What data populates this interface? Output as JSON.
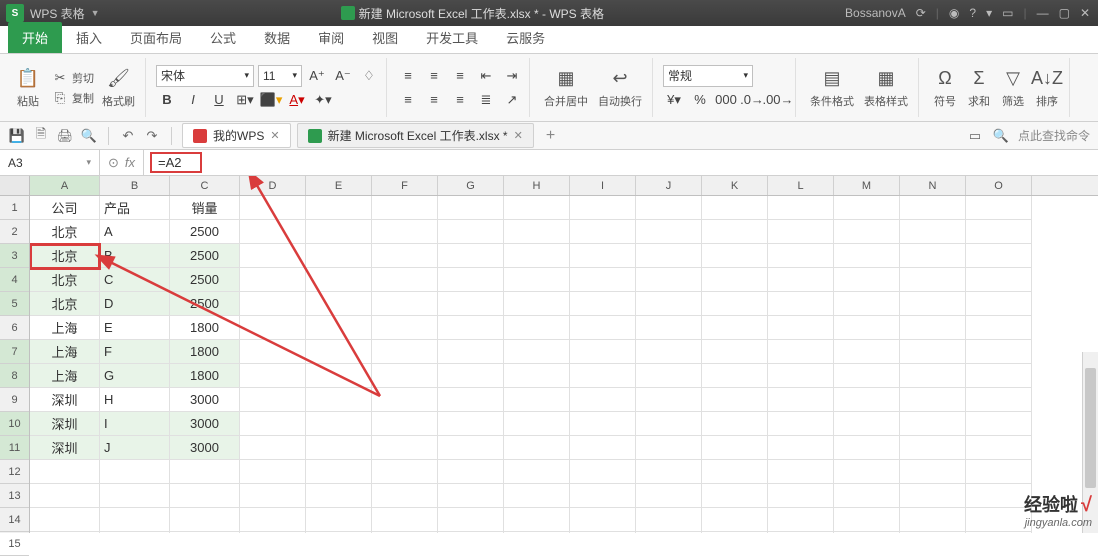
{
  "titlebar": {
    "app_name": "WPS 表格",
    "doc_title": "新建 Microsoft Excel 工作表.xlsx * - WPS 表格",
    "user": "BossanovA",
    "sync_icon": "sync-icon",
    "buttons": [
      "◎",
      "?",
      "▾",
      "▢",
      "—",
      "▢",
      "✕"
    ]
  },
  "menu": {
    "tabs": [
      "开始",
      "插入",
      "页面布局",
      "公式",
      "数据",
      "审阅",
      "视图",
      "开发工具",
      "云服务"
    ],
    "active": 0
  },
  "ribbon": {
    "paste": "粘贴",
    "cut": "剪切",
    "copy": "复制",
    "format_painter": "格式刷",
    "font_name": "宋体",
    "font_size": "11",
    "merge_center": "合并居中",
    "wrap": "自动换行",
    "number_format": "常规",
    "cond_format": "条件格式",
    "table_style": "表格样式",
    "symbol": "符号",
    "sum": "求和",
    "filter": "筛选",
    "sort": "排序"
  },
  "quickbar": {
    "tab1": "我的WPS",
    "tab2": "新建 Microsoft Excel 工作表.xlsx *",
    "search_placeholder": "点此查找命令"
  },
  "formula": {
    "cell_ref": "A3",
    "value": "=A2"
  },
  "columns": [
    "A",
    "B",
    "C",
    "D",
    "E",
    "F",
    "G",
    "H",
    "I",
    "J",
    "K",
    "L",
    "M",
    "N",
    "O"
  ],
  "row_count": 15,
  "active_cell": {
    "row": 3,
    "col": "A"
  },
  "highlight_rows": [
    3,
    4,
    5,
    7,
    8,
    10,
    11
  ],
  "table": {
    "headers": {
      "A": "公司",
      "B": "产品",
      "C": "销量"
    },
    "rows": [
      {
        "A": "北京",
        "B": "A",
        "C": "2500"
      },
      {
        "A": "北京",
        "B": "B",
        "C": "2500"
      },
      {
        "A": "北京",
        "B": "C",
        "C": "2500"
      },
      {
        "A": "北京",
        "B": "D",
        "C": "2500"
      },
      {
        "A": "上海",
        "B": "E",
        "C": "1800"
      },
      {
        "A": "上海",
        "B": "F",
        "C": "1800"
      },
      {
        "A": "上海",
        "B": "G",
        "C": "1800"
      },
      {
        "A": "深圳",
        "B": "H",
        "C": "3000"
      },
      {
        "A": "深圳",
        "B": "I",
        "C": "3000"
      },
      {
        "A": "深圳",
        "B": "J",
        "C": "3000"
      }
    ]
  },
  "watermark": {
    "text": "经验啦",
    "check": "√",
    "url": "jingyanla.com"
  }
}
